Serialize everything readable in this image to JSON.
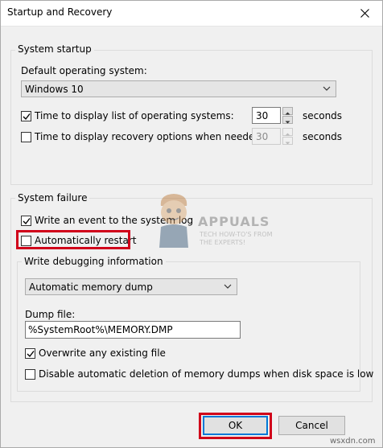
{
  "window": {
    "title": "Startup and Recovery"
  },
  "system_startup": {
    "label": "System startup",
    "default_os_label": "Default operating system:",
    "default_os_value": "Windows 10",
    "display_list": {
      "checked": true,
      "label": "Time to display list of operating systems:",
      "value": "30",
      "unit": "seconds"
    },
    "display_recovery": {
      "checked": false,
      "label": "Time to display recovery options when needed:",
      "value": "30",
      "unit": "seconds"
    }
  },
  "system_failure": {
    "label": "System failure",
    "write_event": {
      "checked": true,
      "label": "Write an event to the system log"
    },
    "auto_restart": {
      "checked": false,
      "label": "Automatically restart"
    },
    "debug": {
      "label": "Write debugging information",
      "dump_type": "Automatic memory dump",
      "dump_file_label": "Dump file:",
      "dump_file_value": "%SystemRoot%\\MEMORY.DMP",
      "overwrite": {
        "checked": true,
        "label": "Overwrite any existing file"
      },
      "disable_auto_delete": {
        "checked": false,
        "label": "Disable automatic deletion of memory dumps when disk space is low"
      }
    }
  },
  "buttons": {
    "ok": "OK",
    "cancel": "Cancel"
  },
  "watermark": {
    "title": "APPUALS",
    "line1": "TECH HOW-TO'S FROM",
    "line2": "THE EXPERTS!"
  },
  "footer": {
    "site": "wsxdn.com"
  },
  "colors": {
    "highlight": "#d0001a",
    "focus": "#0078d7"
  }
}
